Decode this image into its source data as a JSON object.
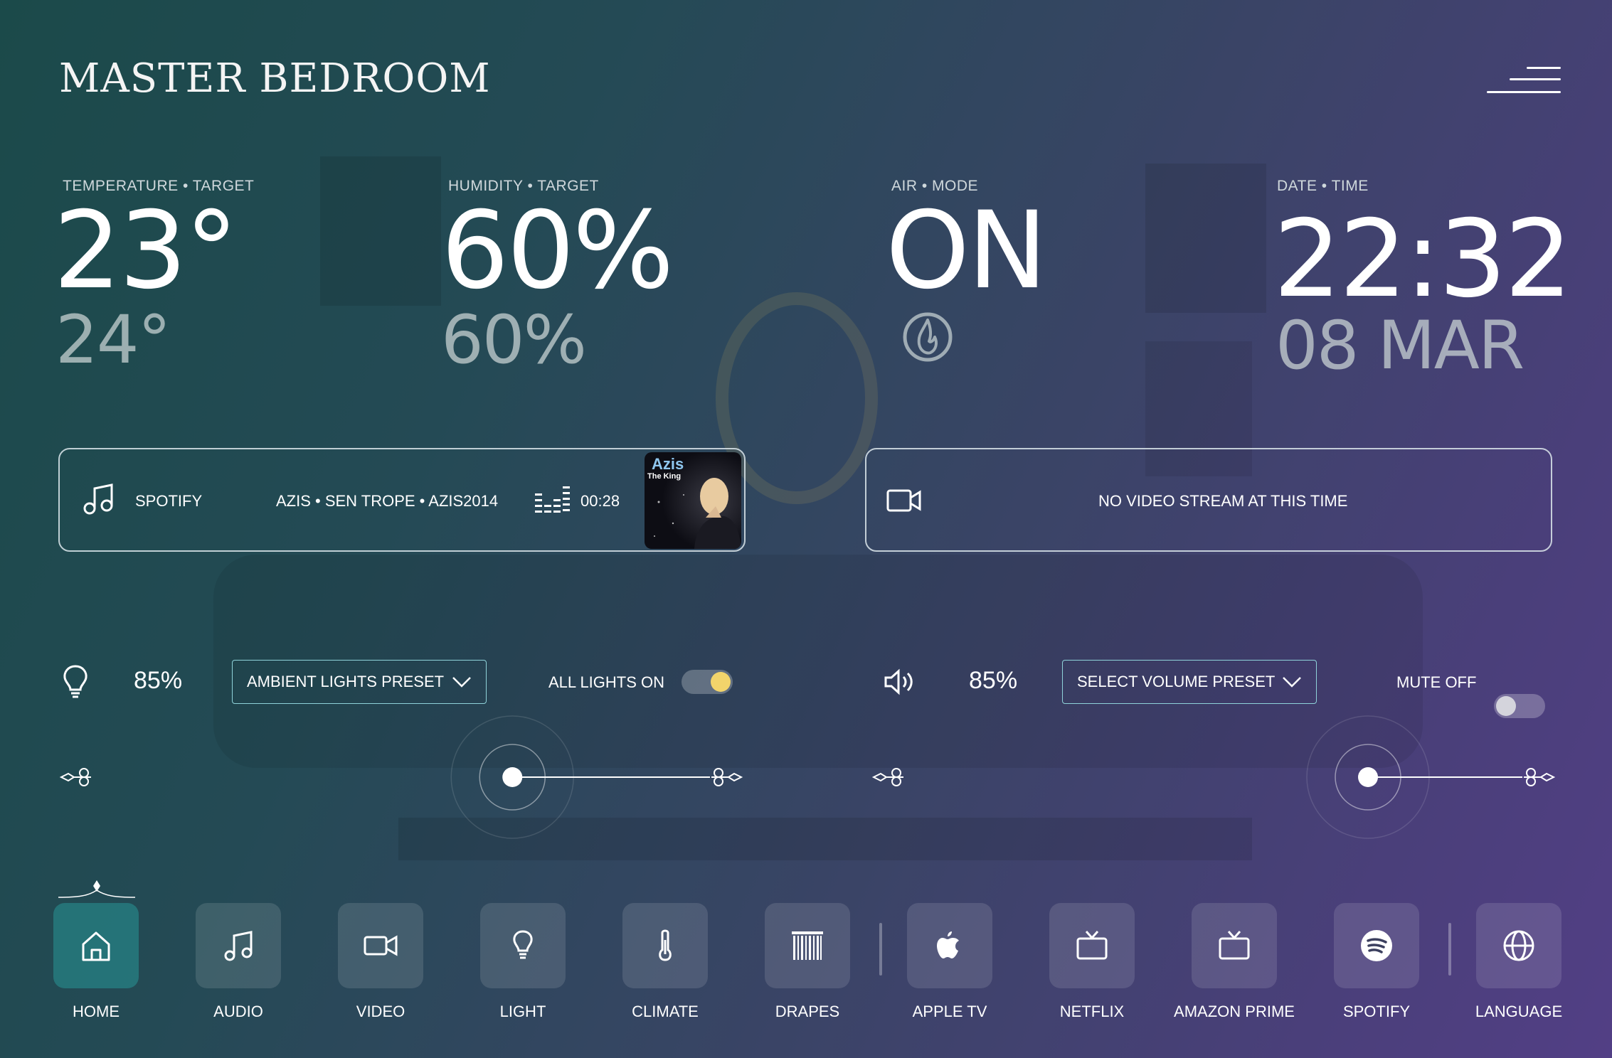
{
  "header": {
    "title": "MASTER BEDROOM"
  },
  "stats": [
    {
      "label": "TEMPERATURE • TARGET",
      "value": "23°",
      "target": "24°"
    },
    {
      "label": "HUMIDITY • TARGET",
      "value": "60%",
      "target": "60%"
    },
    {
      "label": "AIR • MODE",
      "value": "ON",
      "mode_icon": "flame-icon"
    },
    {
      "label": "DATE • TIME",
      "value": "22:32",
      "target": "08 MAR"
    }
  ],
  "audio_panel": {
    "source": "SPOTIFY",
    "track": "AZIS • SEN TROPE • AZIS2014",
    "time": "00:28",
    "album_title": "Azis",
    "album_subtitle": "The King"
  },
  "video_panel": {
    "message": "NO VIDEO STREAM AT THIS TIME"
  },
  "lights": {
    "level": "85%",
    "preset_label": "AMBIENT LIGHTS PRESET",
    "toggle_label": "ALL LIGHTS ON",
    "toggle_on": true,
    "slider_value": 0.68,
    "accent": "#f0a040",
    "knob_color": "#f2d46b"
  },
  "volume": {
    "level": "85%",
    "preset_label": "SELECT VOLUME PRESET",
    "toggle_label": "MUTE OFF",
    "toggle_on": false,
    "slider_value": 0.75,
    "accent": "#7fd3e0"
  },
  "nav": [
    {
      "label": "HOME",
      "icon": "home-icon",
      "active": true
    },
    {
      "label": "AUDIO",
      "icon": "music-note-icon"
    },
    {
      "label": "VIDEO",
      "icon": "video-camera-icon"
    },
    {
      "label": "LIGHT",
      "icon": "light-bulb-icon"
    },
    {
      "label": "CLIMATE",
      "icon": "thermometer-icon"
    },
    {
      "label": "DRAPES",
      "icon": "drapes-icon"
    },
    {
      "label": "APPLE TV",
      "icon": "apple-icon"
    },
    {
      "label": "NETFLIX",
      "icon": "tv-icon"
    },
    {
      "label": "AMAZON PRIME",
      "icon": "tv-icon"
    },
    {
      "label": "SPOTIFY",
      "icon": "spotify-icon"
    },
    {
      "label": "LANGUAGE",
      "icon": "globe-icon"
    }
  ]
}
